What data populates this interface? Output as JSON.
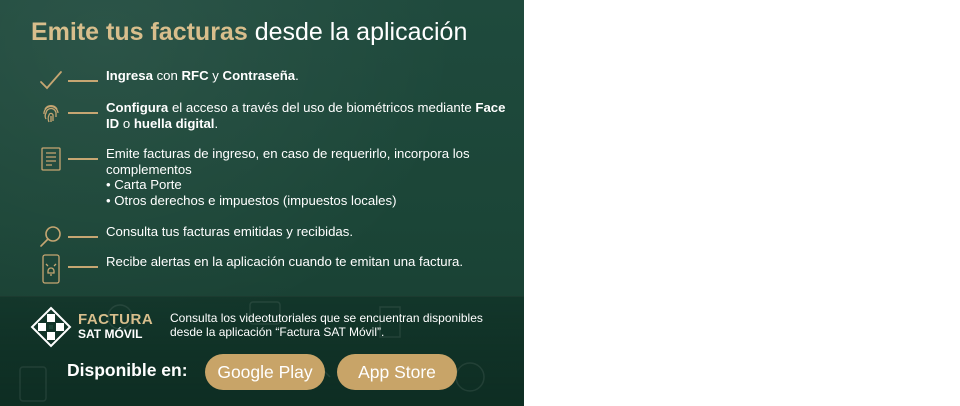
{
  "banner": {
    "title_highlight": "Emite tus facturas",
    "title_rest": " desde la aplicación",
    "items": [
      {
        "icon": "checkmark-icon",
        "parts": [
          {
            "t": "Ingresa",
            "b": true
          },
          {
            "t": " con ",
            "b": false
          },
          {
            "t": "RFC",
            "b": true
          },
          {
            "t": " y ",
            "b": false
          },
          {
            "t": "Contraseña",
            "b": true
          },
          {
            "t": ".",
            "b": false
          }
        ]
      },
      {
        "icon": "fingerprint-icon",
        "parts": [
          {
            "t": "Configura",
            "b": true
          },
          {
            "t": " el acceso a través del uso de biométricos mediante ",
            "b": false
          },
          {
            "t": "Face ID",
            "b": true
          },
          {
            "t": " o ",
            "b": false
          },
          {
            "t": "huella digital",
            "b": true
          },
          {
            "t": ".",
            "b": false
          }
        ]
      },
      {
        "icon": "document-icon",
        "lines": [
          "Emite facturas de ingreso, en caso de requerirlo, incorpora los complementos",
          "• Carta Porte",
          "• Otros derechos e impuestos (impuestos locales)"
        ]
      },
      {
        "icon": "magnifier-icon",
        "lines": [
          "Consulta tus facturas emitidas y recibidas."
        ]
      },
      {
        "icon": "phone-alert-icon",
        "lines": [
          "Recibe alertas en la aplicación cuando te emitan una factura."
        ]
      }
    ],
    "logo": {
      "line1": "FACTURA",
      "line2": "SAT MÓVIL"
    },
    "promo_text": "Consulta los videotutoriales que se encuentran disponibles desde la aplicación “Factura SAT Móvil”.",
    "available_label": "Disponible en:",
    "google_play_label": "Google Play",
    "app_store_label": "App Store",
    "colors": {
      "accent": "#c8a468",
      "title_gold": "#d8be8c",
      "background": "#1f4a3d"
    }
  }
}
